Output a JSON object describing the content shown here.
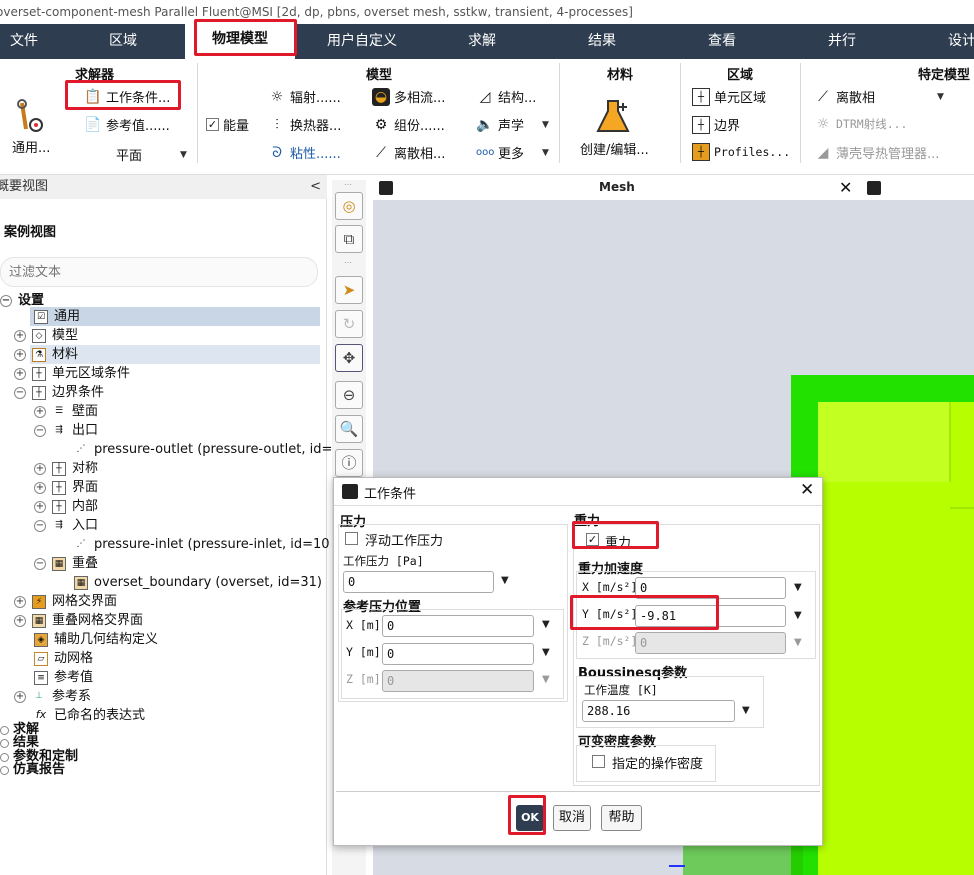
{
  "window": {
    "title": "overset-component-mesh Parallel Fluent@MSI  [2d, dp, pbns, overset mesh, sstkw, transient, 4-processes]"
  },
  "menu": [
    "文件",
    "区域",
    "物理模型",
    "用户自定义",
    "求解",
    "结果",
    "查看",
    "并行",
    "设计"
  ],
  "ribbon": {
    "solver": {
      "title": "求解器",
      "general": "通用...",
      "operating": "工作条件...",
      "reference": "参考值......",
      "plane": "平面"
    },
    "models": {
      "title": "模型",
      "energy": "能量",
      "radiation": "辐射......",
      "heat_exchanger": "换热器...",
      "viscous": "粘性......",
      "multiphase": "多相流...",
      "species": "组份......",
      "dpm": "离散相...",
      "structure": "结构...",
      "acoustics": "声学",
      "more": "更多"
    },
    "materials": {
      "title": "材料",
      "create": "创建/编辑..."
    },
    "zones": {
      "title": "区域",
      "cell_zones": "单元区域",
      "boundaries": "边界",
      "profiles": "Profiles..."
    },
    "specific": {
      "title": "特定模型",
      "discrete_phase": "离散相",
      "dtrm": "DTRM射线...",
      "shell": "薄壳导热管理器..."
    }
  },
  "outline": {
    "header": "概要视图",
    "case_view": "案例视图",
    "filter_placeholder": "过滤文本",
    "tree": [
      "设置",
      "通用",
      "模型",
      "材料",
      "单元区域条件",
      "边界条件",
      "壁面",
      "出口",
      "pressure-outlet (pressure-outlet, id=",
      "对称",
      "界面",
      "内部",
      "入口",
      "pressure-inlet (pressure-inlet, id=10",
      "重叠",
      "overset_boundary (overset, id=31)",
      "网格交界面",
      "重叠网格交界面",
      "辅助几何结构定义",
      "动网格",
      "参考值",
      "参考系",
      "已命名的表达式",
      "求解",
      "结果",
      "参数和定制",
      "仿真报告"
    ]
  },
  "graphics": {
    "tab": "Mesh"
  },
  "dialog": {
    "title": "工作条件",
    "pressure": {
      "title": "压力",
      "floating": "浮动工作压力",
      "op_label": "工作压力 [Pa]",
      "op_value": "0",
      "ref_title": "参考压力位置",
      "x_label": "X [m]",
      "x": "0",
      "y_label": "Y [m]",
      "y": "0",
      "z_label": "Z [m]",
      "z": "0"
    },
    "gravity": {
      "title": "重力",
      "check": "重力",
      "accel_title": "重力加速度",
      "x_label": "X [m/s²]",
      "x": "0",
      "y_label": "Y [m/s²]",
      "y": "-9.81",
      "z_label": "Z [m/s²]",
      "z": "0"
    },
    "boussinesq": {
      "title": "Boussinesq参数",
      "temp_label": "工作温度 [K]",
      "temp": "288.16"
    },
    "density": {
      "title": "可变密度参数",
      "specified": "指定的操作密度"
    },
    "buttons": {
      "ok": "OK",
      "cancel": "取消",
      "help": "帮助"
    }
  },
  "colors": {
    "menubar": "#2e3d4f",
    "highlight": "#e0192b",
    "mesh_green": "#22e000",
    "mesh_yellow": "#b7ff00"
  }
}
